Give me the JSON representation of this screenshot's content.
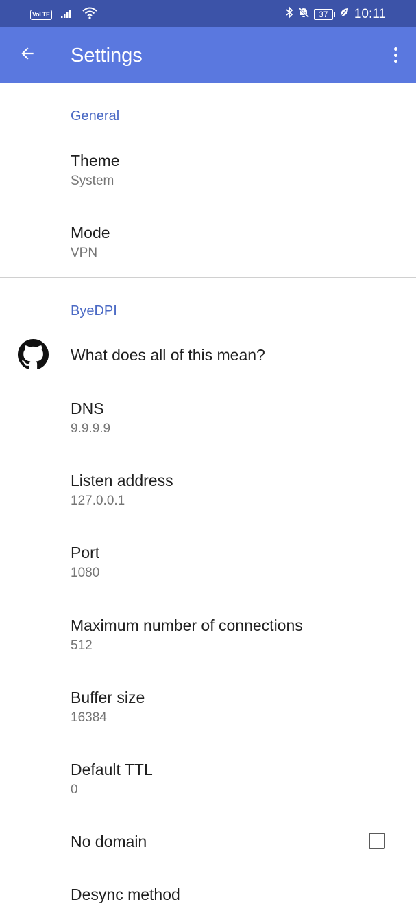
{
  "status_bar": {
    "network_badge": "VoLTE",
    "battery": "37",
    "time": "10:11",
    "icons": [
      "signal-icon",
      "wifi-icon",
      "bluetooth-icon",
      "mute-bell-icon",
      "battery-icon",
      "leaf-icon"
    ]
  },
  "app_bar": {
    "title": "Settings",
    "back_icon": "arrow-back-icon",
    "menu_icon": "more-vert-icon",
    "color": "#5a78df"
  },
  "general": {
    "header": "General",
    "theme": {
      "title": "Theme",
      "summary": "System"
    },
    "mode": {
      "title": "Mode",
      "summary": "VPN"
    }
  },
  "byedpi": {
    "header": "ByeDPI",
    "help": {
      "title": "What does all of this mean?",
      "icon": "github-icon"
    },
    "dns": {
      "title": "DNS",
      "summary": "9.9.9.9"
    },
    "listen_address": {
      "title": "Listen address",
      "summary": "127.0.0.1"
    },
    "port": {
      "title": "Port",
      "summary": "1080"
    },
    "max_connections": {
      "title": "Maximum number of connections",
      "summary": "512"
    },
    "buffer_size": {
      "title": "Buffer size",
      "summary": "16384"
    },
    "default_ttl": {
      "title": "Default TTL",
      "summary": "0"
    },
    "no_domain": {
      "title": "No domain",
      "checked": false
    },
    "desync_method": {
      "title": "Desync method"
    }
  },
  "colors": {
    "accent": "#4a69c4",
    "status_bar": "#3c53a8"
  }
}
